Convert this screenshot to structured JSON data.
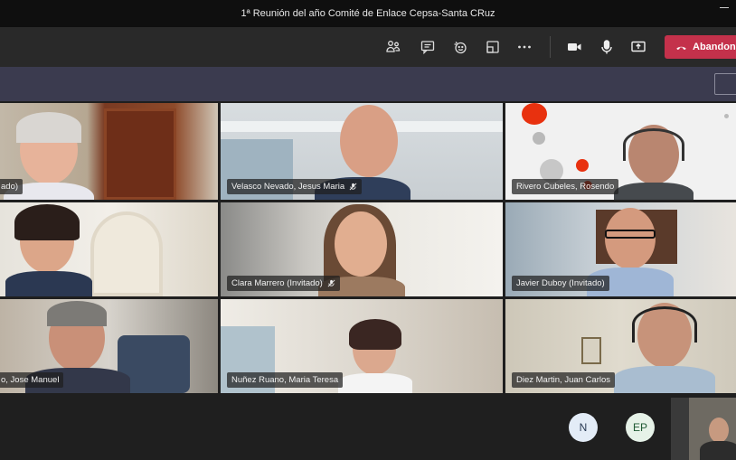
{
  "window": {
    "title": "1ª Reunión del año Comité de Enlace Cepsa-Santa CRuz"
  },
  "toolbar": {
    "buttons": [
      {
        "name": "participants-icon"
      },
      {
        "name": "chat-icon"
      },
      {
        "name": "reactions-icon"
      },
      {
        "name": "rooms-icon"
      },
      {
        "name": "more-options-icon"
      },
      {
        "name": "camera-icon"
      },
      {
        "name": "microphone-icon"
      },
      {
        "name": "share-screen-icon"
      }
    ],
    "leave_label": "Abandonar",
    "leave_color": "#c4314b"
  },
  "participants": [
    {
      "name": "ado)",
      "muted": false
    },
    {
      "name": "Velasco Nevado, Jesus Maria",
      "muted": true
    },
    {
      "name": "Rivero Cubeles, Rosendo",
      "muted": false
    },
    {
      "name": "",
      "muted": false
    },
    {
      "name": "Clara Marrero (Invitado)",
      "muted": true
    },
    {
      "name": "Javier Duboy (Invitado)",
      "muted": false
    },
    {
      "name": "o, Jose Manuel",
      "muted": false
    },
    {
      "name": "Nuñez Ruano, Maria Teresa",
      "muted": false
    },
    {
      "name": "Diez Martin, Juan Carlos",
      "muted": false
    }
  ],
  "avatars": [
    {
      "initials": "N",
      "bg": "#e3ecf7",
      "fg": "#2a3b55"
    },
    {
      "initials": "EP",
      "bg": "#e6f2e8",
      "fg": "#1f5a33"
    }
  ]
}
